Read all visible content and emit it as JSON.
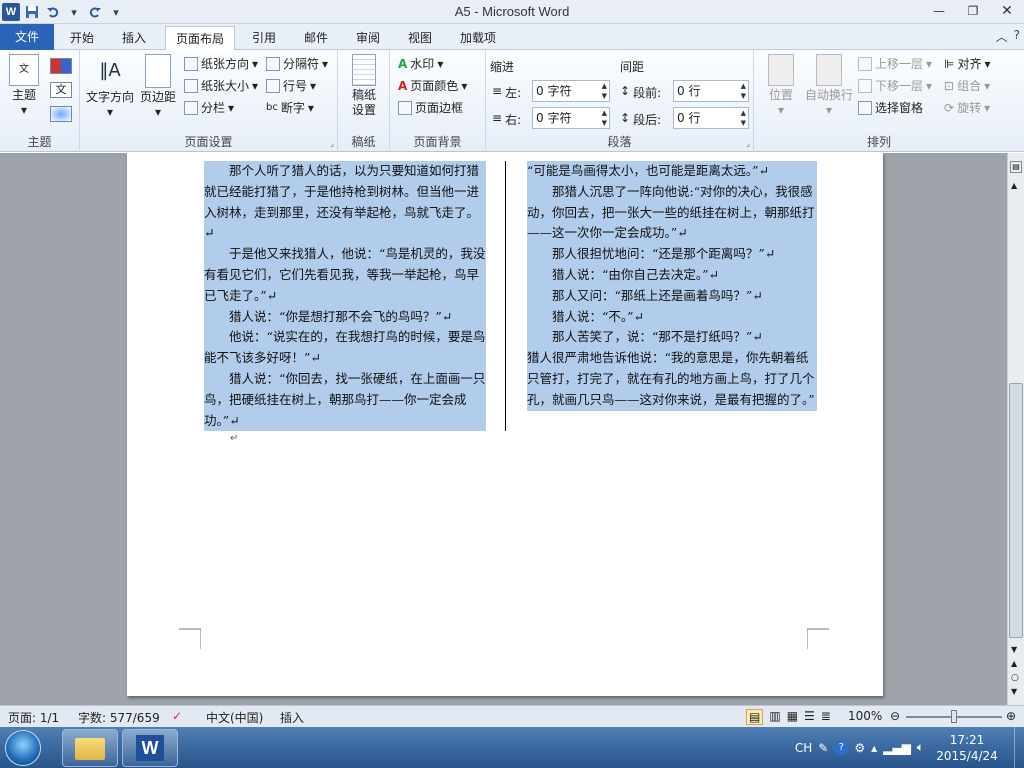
{
  "window": {
    "title": "A5  -  Microsoft Word",
    "controls": {
      "minimize": "—",
      "restore": "❐",
      "close": "✕"
    }
  },
  "quick_access": {
    "app_icon": "W",
    "save_icon": "save-icon",
    "undo_icon": "undo-icon",
    "redo_icon": "redo-icon"
  },
  "tabs": [
    {
      "label": "文件"
    },
    {
      "label": "开始"
    },
    {
      "label": "插入"
    },
    {
      "label": "页面布局"
    },
    {
      "label": "引用"
    },
    {
      "label": "邮件"
    },
    {
      "label": "审阅"
    },
    {
      "label": "视图"
    },
    {
      "label": "加载项"
    }
  ],
  "ribbon": {
    "theme": {
      "label": "主题",
      "group": "主题"
    },
    "page_setup": {
      "text_direction": "文字方向",
      "margins": "页边距",
      "orientation": "纸张方向",
      "size": "纸张大小",
      "columns": "分栏",
      "breaks": "分隔符",
      "line_numbers": "行号",
      "hyphenation": "断字",
      "group": "页面设置"
    },
    "paper": {
      "label": "稿纸\n设置",
      "group": "稿纸"
    },
    "page_background": {
      "watermark": "水印",
      "page_color": "页面颜色",
      "page_borders": "页面边框",
      "group": "页面背景"
    },
    "paragraph": {
      "indent_title": "缩进",
      "spacing_title": "间距",
      "left_label": "左:",
      "left_value": "0 字符",
      "right_label": "右:",
      "right_value": "0 字符",
      "before_label": "段前:",
      "before_value": "0 行",
      "after_label": "段后:",
      "after_value": "0 行",
      "group": "段落"
    },
    "arrange": {
      "position": "位置",
      "wrap": "自动换行",
      "bring_forward": "上移一层",
      "send_backward": "下移一层",
      "selection_pane": "选择窗格",
      "align": "对齐",
      "group_label": "组合",
      "rotate": "旋转",
      "group": "排列"
    }
  },
  "document": {
    "left_column": [
      {
        "text": "那个人听了猎人的话，以为只要知道如何打猎就已经能打猎了，于是他持枪到树林。但当他一进入树林，走到那里，还没有举起枪，鸟就飞走了。↵",
        "indent": true
      },
      {
        "text": "于是他又来找猎人，他说：“鸟是机灵的，我没有看见它们，它们先看见我，等我一举起枪，鸟早已飞走了。”↵",
        "indent": true
      },
      {
        "text": "猎人说：“你是想打那不会飞的鸟吗？”↵",
        "indent": true
      },
      {
        "text": "他说：“说实在的，在我想打鸟的时候，要是鸟能不飞该多好呀！”↵",
        "indent": true
      },
      {
        "text": "猎人说：“你回去，找一张硬纸，在上面画一只鸟，把硬纸挂在树上，朝那鸟打——你一定会成功。”↵",
        "indent": true
      }
    ],
    "right_column": [
      {
        "text": "“可能是鸟画得太小，也可能是距离太远。”↵",
        "indent": false
      },
      {
        "text": "那猎人沉思了一阵向他说:“对你的决心，我很感动，你回去，把一张大一些的纸挂在树上，朝那纸打——这一次你一定会成功。”↵",
        "indent": true
      },
      {
        "text": "那人很担忧地问：“还是那个距离吗？”↵",
        "indent": true
      },
      {
        "text": "猎人说：“由你自己去决定。”↵",
        "indent": true
      },
      {
        "text": "那人又问：“那纸上还是画着鸟吗？”↵",
        "indent": true
      },
      {
        "text": "猎人说：“不。”↵",
        "indent": true
      },
      {
        "text": "那人苦笑了，说：“那不是打纸吗？”↵",
        "indent": true
      },
      {
        "text": "猎人很严肃地告诉他说：“我的意思是，你先朝着纸只管打，打完了，就在有孔的地方画上鸟，打了几个孔，就画几只鸟——这对你来说，是最有把握的了。”",
        "indent": false
      }
    ],
    "end_mark": "↵"
  },
  "status_bar": {
    "page": "页面: 1/1",
    "words": "字数: 577/659",
    "language": "中文(中国)",
    "mode": "插入",
    "zoom": "100%"
  },
  "taskbar": {
    "ime": "CH",
    "time": "17:21",
    "date": "2015/4/24"
  }
}
